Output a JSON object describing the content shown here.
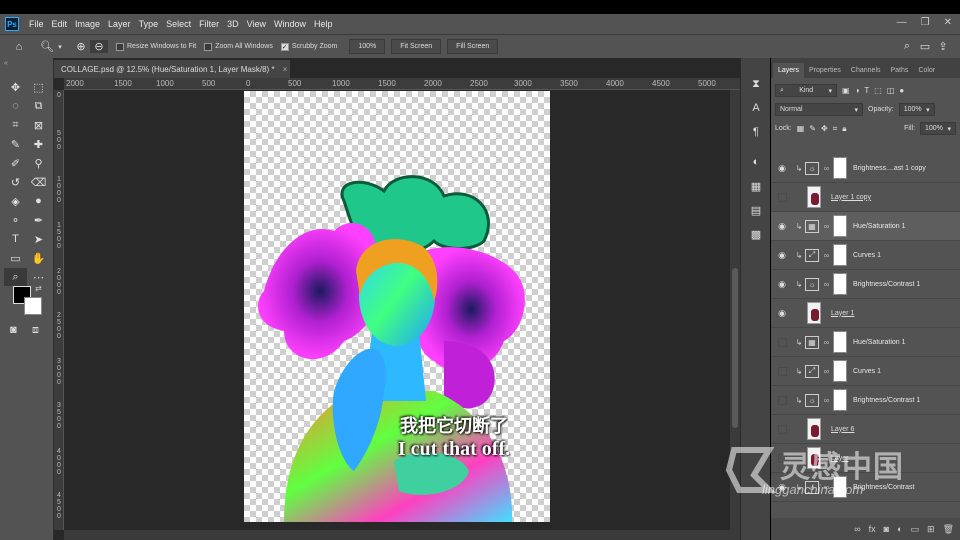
{
  "app": {
    "logo": "Ps"
  },
  "menu": [
    "File",
    "Edit",
    "Image",
    "Layer",
    "Type",
    "Select",
    "Filter",
    "3D",
    "View",
    "Window",
    "Help"
  ],
  "window_controls": {
    "minimize": "—",
    "restore": "❐",
    "close": "✕"
  },
  "options_bar": {
    "home_icon": "home-icon",
    "zoom_icon": "zoom-icon",
    "resize_windows": {
      "label": "Resize Windows to Fit",
      "checked": false
    },
    "zoom_all_windows": {
      "label": "Zoom All Windows",
      "checked": false
    },
    "scrubby_zoom": {
      "label": "Scrubby Zoom",
      "checked": true
    },
    "zoom_value": "100%",
    "fit_screen": "Fit Screen",
    "fill_screen": "Fill Screen"
  },
  "document": {
    "tab_title": "COLLAGE.psd @ 12.5% (Hue/Saturation 1, Layer Mask/8) *",
    "close": "×",
    "ruler_h": [
      "2000",
      "1500",
      "1000",
      "500",
      "0",
      "500",
      "1000",
      "1500",
      "2000",
      "2500",
      "3000",
      "3500",
      "4000",
      "4500",
      "5000"
    ],
    "ruler_v": [
      "0",
      "5 0 0",
      "1 0 0 0",
      "1 5 0 0",
      "2 0 0 0",
      "2 5 0 0",
      "3 0 0 0",
      "3 5 0 0",
      "4 0 0 0",
      "4 5 0 0"
    ]
  },
  "subtitles": {
    "chinese": "我把它切断了",
    "english": "I cut that off."
  },
  "panel_tabs": [
    "Layers",
    "Properties",
    "Channels",
    "Paths",
    "Color"
  ],
  "layers_panel": {
    "filter_kind": "Kind",
    "blend_mode": "Normal",
    "opacity_label": "Opacity:",
    "opacity": "100%",
    "lock_label": "Lock:",
    "fill_label": "Fill:",
    "fill": "100%",
    "layers": [
      {
        "name": "Brightness....ast 1 copy",
        "type": "adjustment",
        "icon": "☼",
        "visible": true,
        "clipped": true
      },
      {
        "name": "Layer 1 copy",
        "type": "pixel",
        "visible": false,
        "clipped": false
      },
      {
        "name": "Hue/Saturation 1",
        "type": "adjustment",
        "icon": "▦",
        "visible": true,
        "clipped": true
      },
      {
        "name": "Curves 1",
        "type": "adjustment",
        "icon": "⤢",
        "visible": true,
        "clipped": true
      },
      {
        "name": "Brightness/Contrast 1",
        "type": "adjustment",
        "icon": "☼",
        "visible": true,
        "clipped": true
      },
      {
        "name": "Layer 1",
        "type": "pixel",
        "visible": true,
        "clipped": false
      },
      {
        "name": "Hue/Saturation 1",
        "type": "adjustment",
        "icon": "▦",
        "visible": false,
        "clipped": true
      },
      {
        "name": "Curves 1",
        "type": "adjustment",
        "icon": "⤢",
        "visible": false,
        "clipped": true
      },
      {
        "name": "Brightness/Contrast 1",
        "type": "adjustment",
        "icon": "☼",
        "visible": false,
        "clipped": true
      },
      {
        "name": "Layer 6",
        "type": "pixel",
        "visible": false,
        "clipped": false
      },
      {
        "name": "Layer",
        "type": "pixel",
        "visible": false,
        "clipped": false
      },
      {
        "name": "Brightness/Contrast",
        "type": "adjustment",
        "icon": "☼",
        "visible": true,
        "clipped": true
      }
    ]
  },
  "watermark": {
    "chinese": "灵感中国",
    "english": "lingganchina.com"
  },
  "colors": {
    "app_bg": "#535353",
    "canvas_bg": "#282828",
    "menubar": "#535353"
  }
}
